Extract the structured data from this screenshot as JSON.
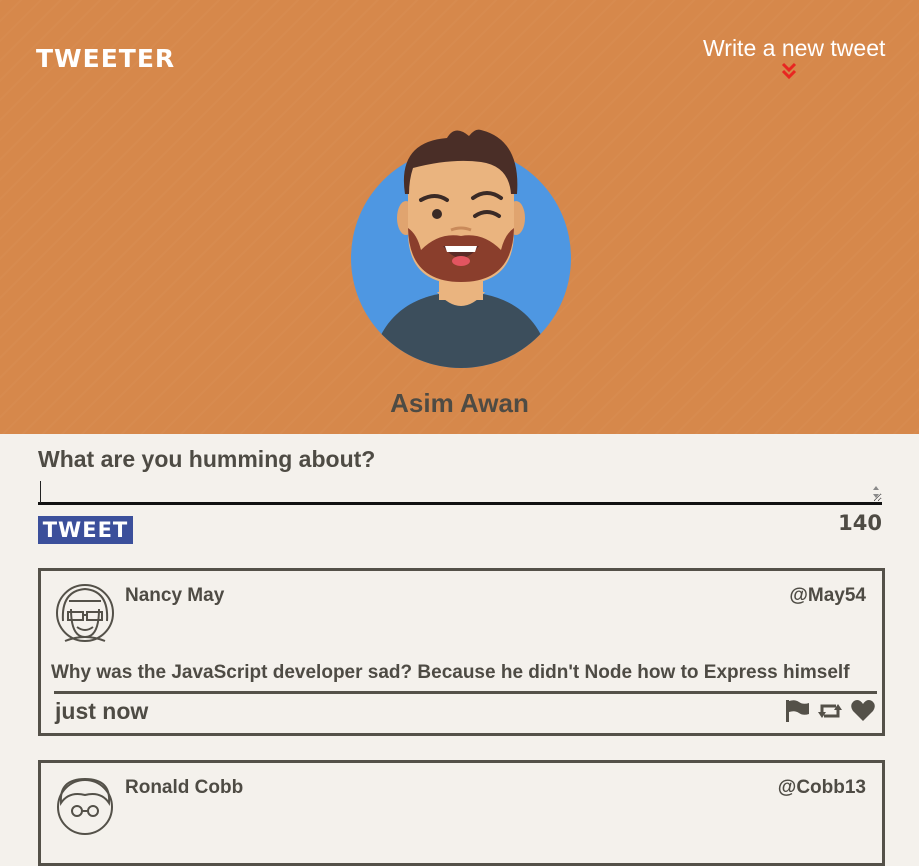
{
  "nav": {
    "brand": "TWEETER",
    "compose_link": "Write a new tweet",
    "compose_icon": "double-chevron-down-icon",
    "accent": "#e82621"
  },
  "profile": {
    "name": "Asim Awan",
    "header_color": "#d6884b"
  },
  "composer": {
    "title": "What are you humming about?",
    "input_value": "",
    "button_label": "TWEET",
    "button_color": "#3b4f9b",
    "counter": "140"
  },
  "tweets": [
    {
      "name": "Nancy May",
      "handle": "@May54",
      "text": "Why was the JavaScript developer sad? Because he didn't Node how to Express himself",
      "time": "just now",
      "actions": [
        "flag-icon",
        "retweet-icon",
        "heart-icon"
      ]
    },
    {
      "name": "Ronald Cobb",
      "handle": "@Cobb13"
    }
  ]
}
